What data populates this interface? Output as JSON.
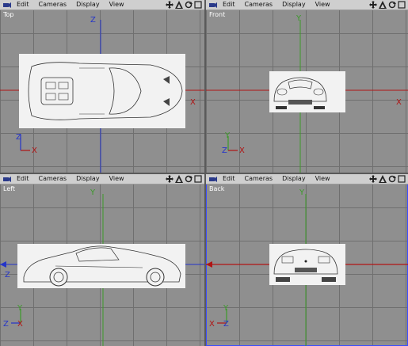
{
  "menus": {
    "edit": "Edit",
    "cameras_top": "Cameras",
    "cameras_front": "Cameras",
    "cameras_left": "Cameras",
    "cameras_back": "Cameras",
    "display": "Display",
    "view": "View"
  },
  "viewports": {
    "top": {
      "title": "Top"
    },
    "front": {
      "title": "Front"
    },
    "left": {
      "title": "Left"
    },
    "back": {
      "title": "Back"
    }
  },
  "axes": {
    "x": "X",
    "y": "Y",
    "z": "Z"
  },
  "colors": {
    "x_axis": "#b01414",
    "y_axis": "#3c9a2a",
    "z_axis": "#2535c8",
    "grid": "#8f8f8f",
    "active_border": "#3a4cff"
  },
  "icons": [
    "camera-icon",
    "move-view-icon",
    "zoom-view-icon",
    "rotate-view-icon",
    "maximize-view-icon"
  ]
}
